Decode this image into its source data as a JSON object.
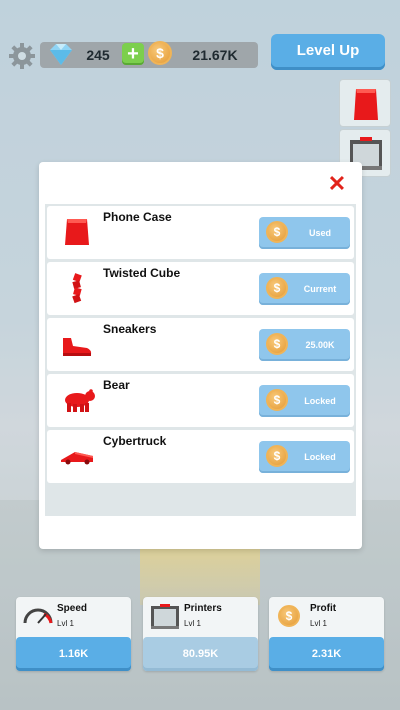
{
  "currency": {
    "gems": "245",
    "coins": "21.67K",
    "add_symbol": "+",
    "coin_symbol": "$"
  },
  "header": {
    "level_up_label": "Level Up"
  },
  "modal": {
    "close_symbol": "✕",
    "items": [
      {
        "name": "Phone Case",
        "button": "Used",
        "icon": "phone-case-icon"
      },
      {
        "name": "Twisted Cube",
        "button": "Current",
        "icon": "twisted-cube-icon"
      },
      {
        "name": "Sneakers",
        "button": "25.00K",
        "icon": "sneaker-icon"
      },
      {
        "name": "Bear",
        "button": "Locked",
        "icon": "bear-icon"
      },
      {
        "name": "Cybertruck",
        "button": "Locked",
        "icon": "cybertruck-icon"
      }
    ]
  },
  "upgrades": [
    {
      "title": "Speed",
      "level": "Lvl 1",
      "value": "1.16K",
      "icon": "speedometer-icon"
    },
    {
      "title": "Printers",
      "level": "Lvl 1",
      "value": "80.95K",
      "icon": "printer-icon"
    },
    {
      "title": "Profit",
      "level": "Lvl 1",
      "value": "2.31K",
      "icon": "coin-icon"
    }
  ],
  "colors": {
    "accent_blue": "#5aaee6",
    "item_red": "#e8191b",
    "close_red": "#e2231a"
  }
}
